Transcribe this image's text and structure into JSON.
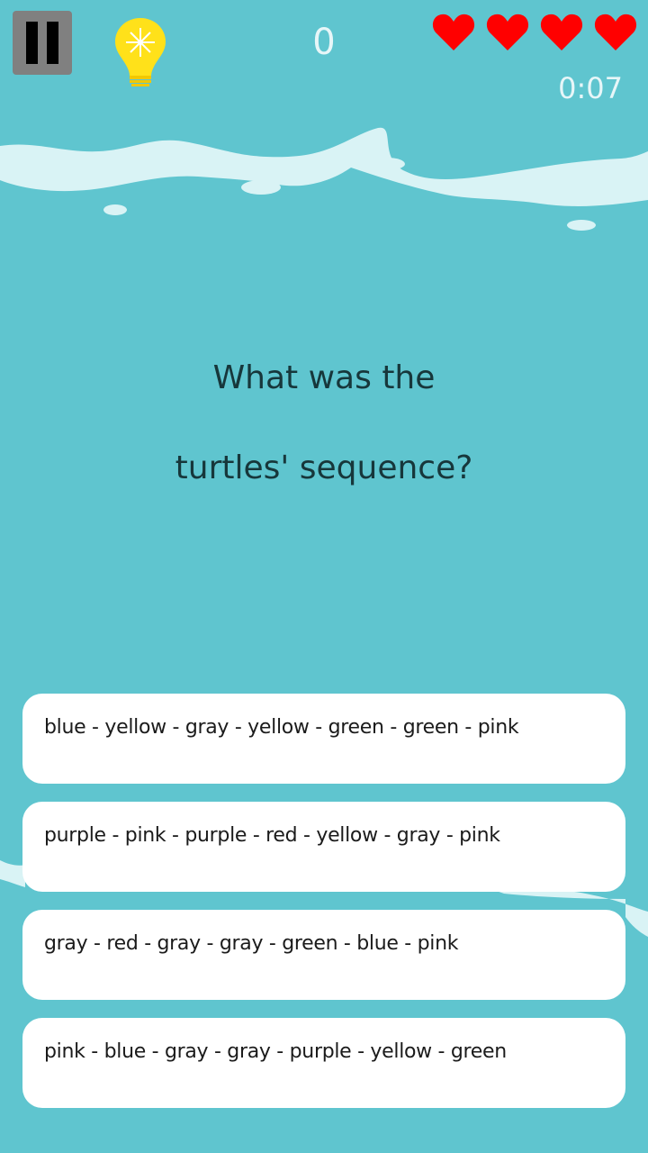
{
  "hud": {
    "score": "0",
    "lives_remaining": 4,
    "timer": "0:07"
  },
  "icons": {
    "pause": "pause-icon",
    "hint": "lightbulb-icon",
    "life": "heart-icon"
  },
  "colors": {
    "background": "#5fc5cf",
    "water_foam": "#d9f3f5",
    "heart": "#ff0000",
    "bulb": "#ffe11a",
    "question_text": "#17373b",
    "answer_card": "#ffffff"
  },
  "question": {
    "line1": "What was the",
    "line2": "turtles' sequence?"
  },
  "answers": [
    {
      "label": "blue - yellow - gray - yellow - green - green - pink"
    },
    {
      "label": "purple - pink - purple - red - yellow - gray - pink"
    },
    {
      "label": "gray - red - gray - gray - green - blue - pink"
    },
    {
      "label": "pink - blue - gray - gray - purple - yellow - green"
    }
  ]
}
